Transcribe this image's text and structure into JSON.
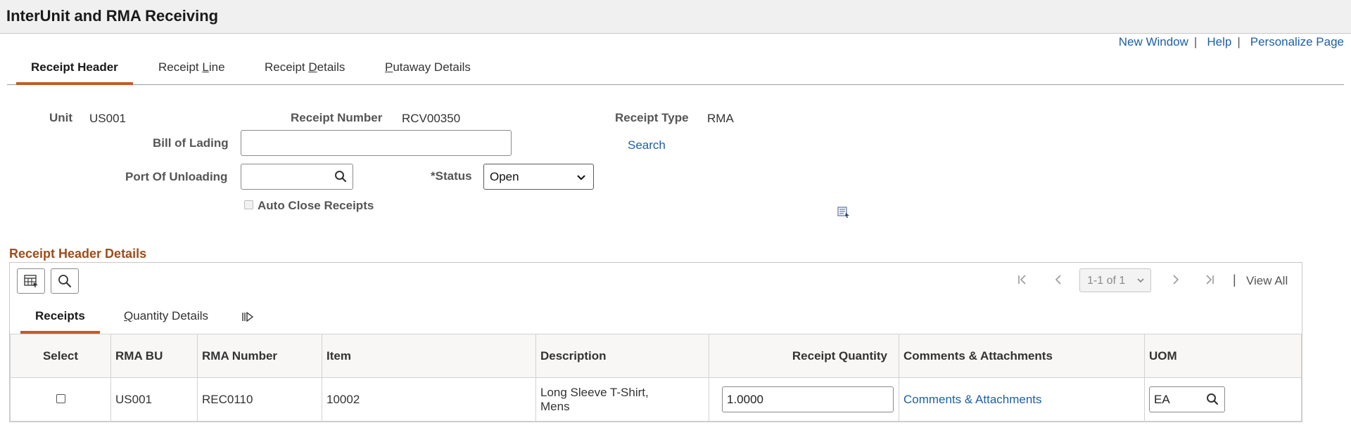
{
  "page": {
    "title": "InterUnit and RMA Receiving"
  },
  "toplinks": {
    "new_window": "New Window",
    "help": "Help",
    "personalize": "Personalize Page",
    "separator": "|"
  },
  "tabs": [
    {
      "label_pre": "Receipt Header",
      "label_u": "",
      "label_post": "",
      "active": true
    },
    {
      "label_pre": "Receipt ",
      "label_u": "L",
      "label_post": "ine",
      "active": false
    },
    {
      "label_pre": "Receipt ",
      "label_u": "D",
      "label_post": "etails",
      "active": false
    },
    {
      "label_pre": "",
      "label_u": "P",
      "label_post": "utaway Details",
      "active": false
    }
  ],
  "form": {
    "unit_label": "Unit",
    "unit_value": "US001",
    "receipt_number_label": "Receipt Number",
    "receipt_number_value": "RCV00350",
    "receipt_type_label": "Receipt Type",
    "receipt_type_value": "RMA",
    "bill_of_lading_label": "Bill of Lading",
    "bill_of_lading_value": "",
    "search_link": "Search",
    "port_label": "Port Of Unloading",
    "port_value": "",
    "status_label": "*Status",
    "status_value": "Open",
    "auto_close_label": "Auto Close Receipts",
    "auto_close_checked": false
  },
  "details": {
    "section_title": "Receipt Header Details",
    "pager_text": "1-1 of 1",
    "view_all": "View All",
    "pipe": "|",
    "subtabs": [
      {
        "label_pre": "Receipts",
        "label_u": "",
        "label_post": "",
        "active": true
      },
      {
        "label_pre": "",
        "label_u": "Q",
        "label_post": "uantity Details",
        "active": false
      }
    ],
    "columns": {
      "select": "Select",
      "rma_bu": "RMA BU",
      "rma_number": "RMA Number",
      "item": "Item",
      "description": "Description",
      "receipt_quantity": "Receipt Quantity",
      "comments": "Comments & Attachments",
      "uom": "UOM"
    },
    "rows": [
      {
        "selected": false,
        "rma_bu": "US001",
        "rma_number": "REC0110",
        "item": "10002",
        "description_line1": "Long Sleeve T-Shirt,",
        "description_line2": "Mens",
        "receipt_quantity": "1.0000",
        "comments_link": "Comments & Attachments",
        "uom": "EA"
      }
    ]
  },
  "colors": {
    "accent": "#c35b22",
    "link": "#1d5fa8",
    "section_title": "#9b4e1d"
  }
}
